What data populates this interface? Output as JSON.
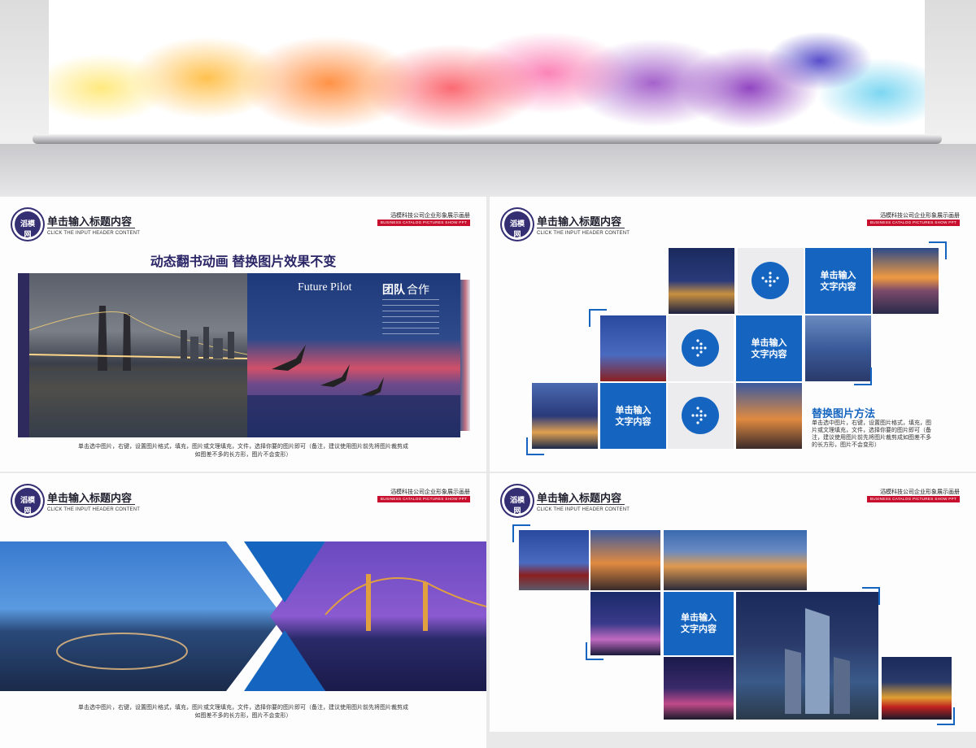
{
  "header": {
    "logo_text": "滔模网",
    "title": "单击输入标题内容",
    "subtitle": "CLICK THE INPUT HEADER CONTENT",
    "company": "滔模科技公司企业形象展示画册",
    "catalog": "BUSINESS CATALOG PICTURES SHOW PPT"
  },
  "slide1": {
    "headline": "动态翻书动画  替换图片效果不变",
    "book_title_latin": "Future Pilot",
    "book_title_cn_bold": "团队",
    "book_title_cn": "合作",
    "caption_line1": "单击选中图片，右键，设置图片格式，填充，图片或文理填充，文件，选择你要的图片即可（备注，建议使用图片前先将图片裁剪成",
    "caption_line2": "如图差不多的长方形，图片不会变形）"
  },
  "slide2": {
    "box1": "单击输入\n文字内容",
    "box2": "单击输入\n文字内容",
    "box3": "单击输入\n文字内容",
    "method_title": "替换图片方法",
    "method_text": "单击选中图片，右键，设置图片格式，填充，图片或文理填充，文件，选择你要的图片即可（备注，建议使用图片前先将图片裁剪成如图差不多的长方形，图片不会变形）"
  },
  "slide3": {
    "caption_line1": "单击选中图片，右键，设置图片格式，填充，图片或文理填充，文件，选择你要的图片即可（备注，建议使用图片前先将图片裁剪成",
    "caption_line2": "如图差不多的长方形，图片不会变形）"
  },
  "slide4": {
    "box": "单击输入\n文字内容"
  },
  "colors": {
    "accent_blue": "#1565c0",
    "brand_purple": "#342e73",
    "catalog_red": "#c8102e"
  }
}
